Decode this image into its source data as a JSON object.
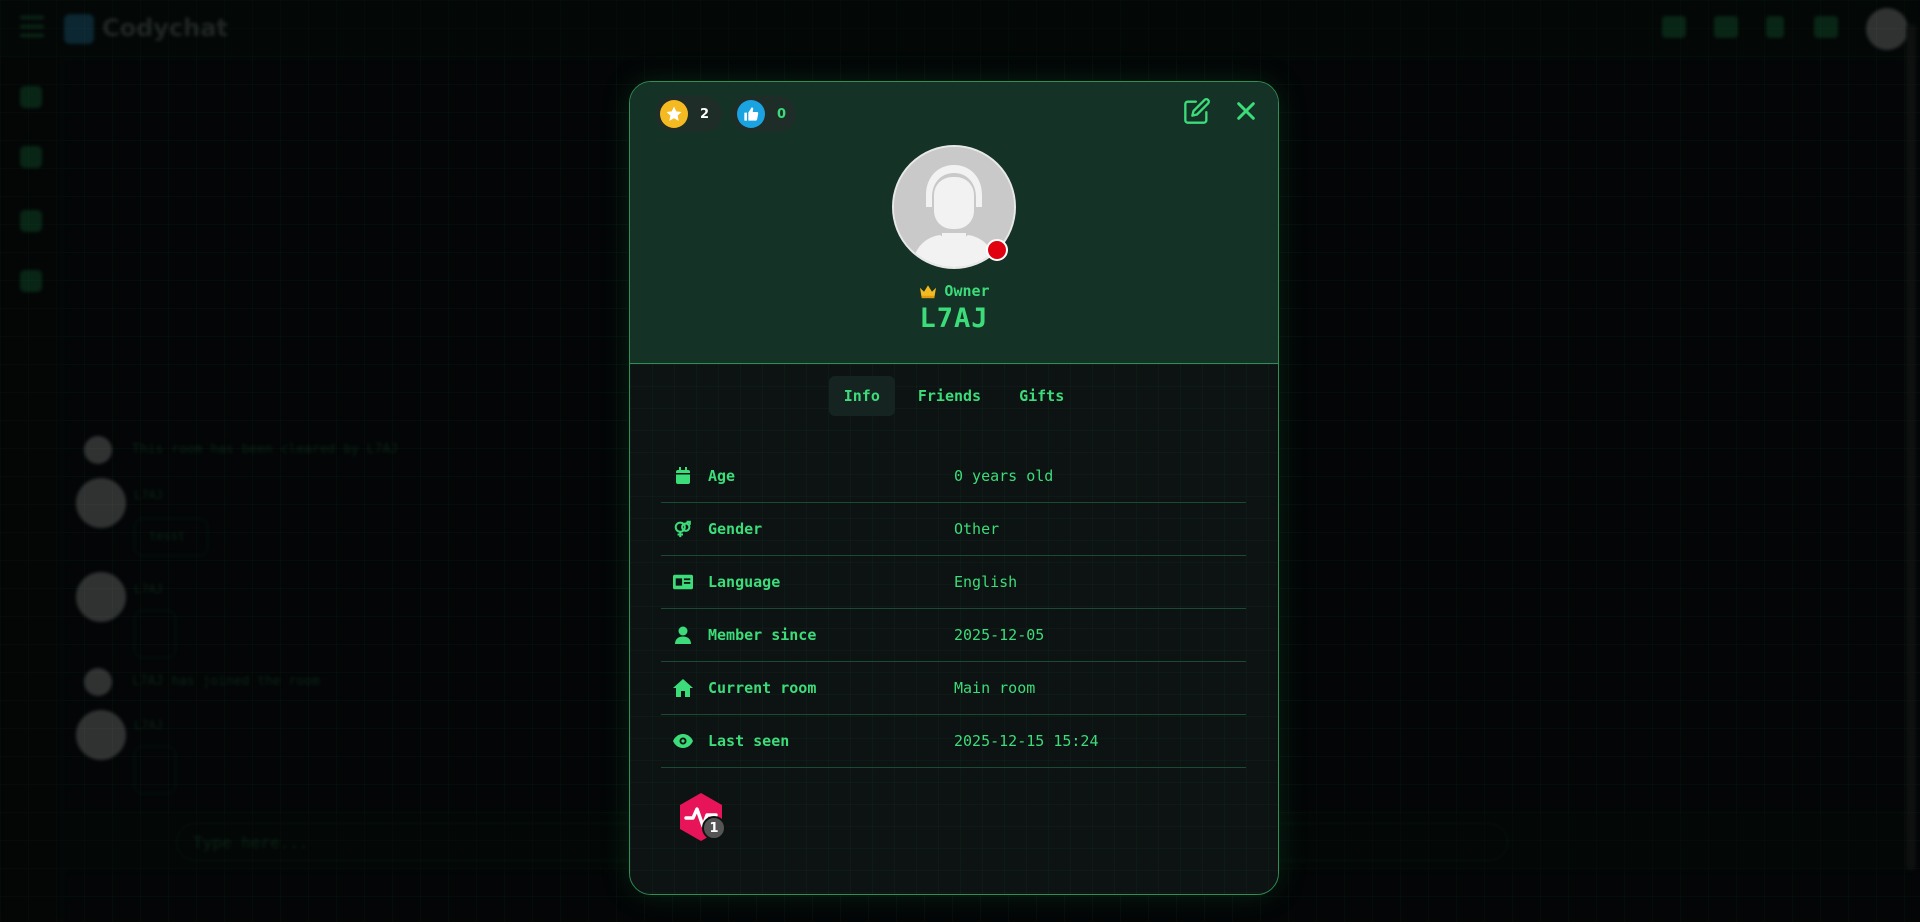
{
  "app": {
    "brand_name": "Codychat"
  },
  "background": {
    "system_message_1": "This room has been cleared by L7AJ",
    "chat_name_1": "L7AJ",
    "chat_text_1": "tesst",
    "chat_name_2": "L7AJ",
    "system_message_2": "L7AJ has joined the room",
    "chat_name_3": "L7AJ",
    "composer_placeholder": "Type here..."
  },
  "profile": {
    "points": "2",
    "likes": "0",
    "rank_label": "Owner",
    "username": "L7AJ",
    "tabs": [
      {
        "label": "Info"
      },
      {
        "label": "Friends"
      },
      {
        "label": "Gifts"
      }
    ],
    "info": [
      {
        "label": "Age",
        "value": "0 years old"
      },
      {
        "label": "Gender",
        "value": "Other"
      },
      {
        "label": "Language",
        "value": "English"
      },
      {
        "label": "Member since",
        "value": "2025-12-05"
      },
      {
        "label": "Current room",
        "value": "Main room"
      },
      {
        "label": "Last seen",
        "value": "2025-12-15 15:24"
      }
    ],
    "badge_count": "1"
  },
  "colors": {
    "accent": "#3ddc7a",
    "header_bg": "#143225",
    "status_offline": "#e00010",
    "points_gold": "#f5b921",
    "likes_blue": "#1aa3e0",
    "badge_pink": "#e8145a"
  }
}
